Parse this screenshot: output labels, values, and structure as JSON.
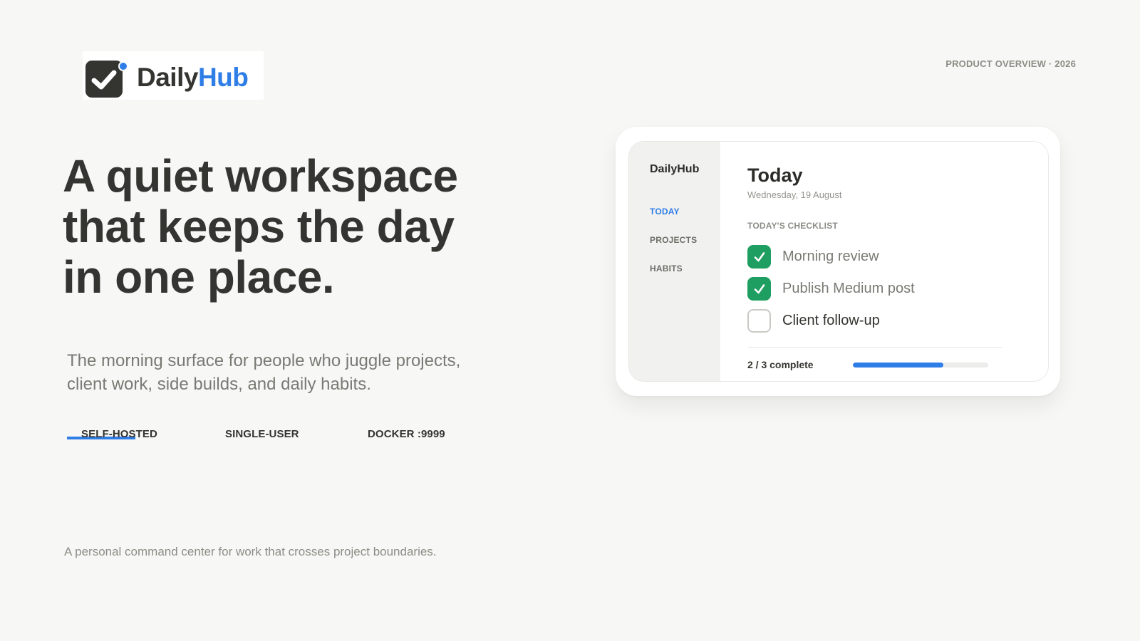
{
  "brand": {
    "name_part1": "Daily",
    "name_part2": "Hub",
    "accent_color": "#2f7ee8",
    "icon": "checkbox-check-icon"
  },
  "header": {
    "overview_label": "PRODUCT OVERVIEW · 2026"
  },
  "hero": {
    "headline_lines": [
      "A quiet workspace",
      "that keeps the day",
      "in one place."
    ],
    "subtitle_lines": [
      "The morning surface for people who juggle projects,",
      "client work, side builds, and daily habits."
    ],
    "tags": [
      "SELF-HOSTED",
      "SINGLE-USER",
      "DOCKER :9999"
    ]
  },
  "footer": {
    "tagline": "A personal command center for work that crosses project boundaries."
  },
  "app_mock": {
    "brand": "DailyHub",
    "nav": [
      {
        "label": "TODAY",
        "active": true
      },
      {
        "label": "PROJECTS",
        "active": false
      },
      {
        "label": "HABITS",
        "active": false
      }
    ],
    "title": "Today",
    "date": "Wednesday, 19 August",
    "section_label": "TODAY'S CHECKLIST",
    "checklist": [
      {
        "label": "Morning review",
        "done": true
      },
      {
        "label": "Publish Medium post",
        "done": true
      },
      {
        "label": "Client follow-up",
        "done": false
      }
    ],
    "progress_text": "2 / 3 complete",
    "progress_fraction": 0.667,
    "check_color": "#1f9e61"
  }
}
